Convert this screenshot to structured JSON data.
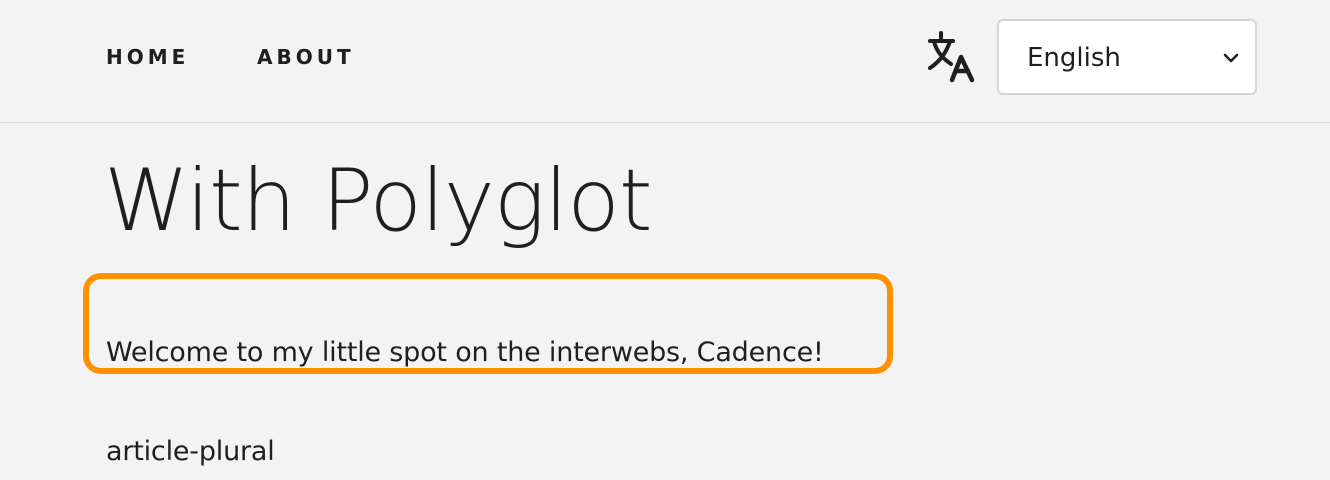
{
  "nav": {
    "home_label": "HOME",
    "about_label": "ABOUT"
  },
  "language": {
    "icon": "translate-icon",
    "selected": "English",
    "options": [
      "English"
    ]
  },
  "main": {
    "title": "With Polyglot",
    "welcome_text": "Welcome to my little spot on the interwebs, Cadence!",
    "article_plural_text": "article-plural"
  },
  "colors": {
    "background": "#f3f3f3",
    "text": "#1f1f1f",
    "highlight": "#ff9000",
    "select_background": "#ffffff",
    "select_border": "#d6d6d6"
  }
}
